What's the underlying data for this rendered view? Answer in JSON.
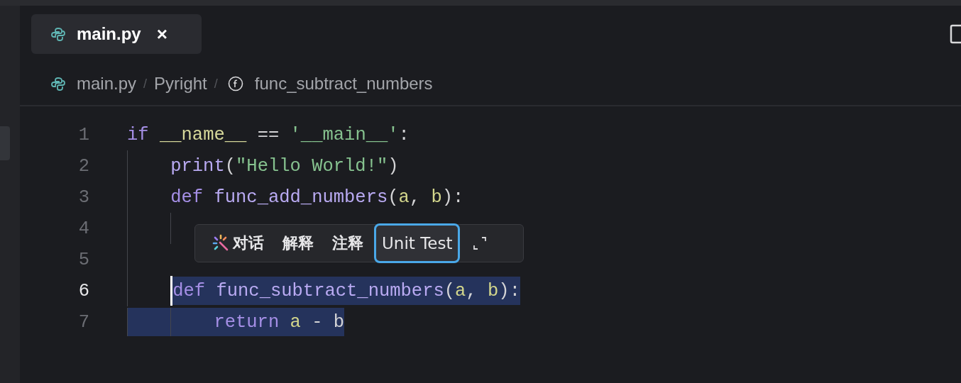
{
  "tabs": [
    {
      "label": "main.py",
      "close": "×",
      "selected": true
    }
  ],
  "breadcrumb": [
    {
      "kind": "file",
      "text": "main.py"
    },
    {
      "kind": "separator",
      "text": "/"
    },
    {
      "kind": "plain",
      "text": "Pyright"
    },
    {
      "kind": "separator",
      "text": "/"
    },
    {
      "kind": "function",
      "text": "func_subtract_numbers"
    }
  ],
  "lines": [
    {
      "number": "1",
      "current": false,
      "cursor": false,
      "tokens": [
        {
          "kind": "keyword",
          "text": "if ",
          "selected": false
        },
        {
          "kind": "dunder",
          "text": "__name__",
          "selected": false
        },
        {
          "kind": "plain",
          "text": " == ",
          "selected": false
        },
        {
          "kind": "string",
          "text": "'__main__'",
          "selected": false
        },
        {
          "kind": "plain",
          "text": ":",
          "selected": false
        }
      ],
      "children": [
        {
          "number": "2",
          "current": false,
          "cursor": false,
          "indent_selected": false,
          "tokens": [
            {
              "kind": "function",
              "text": "print",
              "selected": false
            },
            {
              "kind": "plain",
              "text": "(",
              "selected": false
            },
            {
              "kind": "string",
              "text": "\"Hello World!\"",
              "selected": false
            },
            {
              "kind": "plain",
              "text": ")",
              "selected": false
            }
          ]
        },
        {
          "number": "3",
          "current": false,
          "cursor": false,
          "indent_selected": false,
          "tokens": [
            {
              "kind": "keyword",
              "text": "def ",
              "selected": false
            },
            {
              "kind": "function",
              "text": "func_add_numbers",
              "selected": false
            },
            {
              "kind": "plain",
              "text": "(",
              "selected": false
            },
            {
              "kind": "param",
              "text": "a",
              "selected": false
            },
            {
              "kind": "plain",
              "text": ", ",
              "selected": false
            },
            {
              "kind": "param",
              "text": "b",
              "selected": false
            },
            {
              "kind": "plain",
              "text": "):",
              "selected": false
            }
          ],
          "children": [
            {
              "number": "4",
              "current": false,
              "cursor": false,
              "indent_selected": false
            }
          ]
        },
        {
          "number": "5",
          "current": false,
          "cursor": false,
          "indent_selected": false
        },
        {
          "number": "6",
          "current": true,
          "cursor": true,
          "indent_selected": false,
          "tokens": [
            {
              "kind": "keyword",
              "text": "def ",
              "selected": true
            },
            {
              "kind": "function",
              "text": "func_subtract_numbers",
              "selected": true
            },
            {
              "kind": "plain",
              "text": "(",
              "selected": true
            },
            {
              "kind": "param",
              "text": "a",
              "selected": true
            },
            {
              "kind": "plain",
              "text": ", ",
              "selected": true
            },
            {
              "kind": "param",
              "text": "b",
              "selected": true
            },
            {
              "kind": "plain",
              "text": "):",
              "selected": true
            }
          ],
          "children": [
            {
              "number": "7",
              "current": false,
              "cursor": false,
              "indent_selected": true,
              "tokens": [
                {
                  "kind": "keyword",
                  "text": "return ",
                  "selected": true
                },
                {
                  "kind": "param",
                  "text": "a",
                  "selected": true
                },
                {
                  "kind": "plain",
                  "text": " - ",
                  "selected": true
                },
                {
                  "kind": "plain",
                  "text": "b",
                  "selected": true
                }
              ]
            }
          ]
        }
      ]
    }
  ],
  "popup": {
    "actions": [
      {
        "kind": "chat",
        "label": "对话",
        "selected": false
      },
      {
        "kind": "text",
        "label": "解释",
        "selected": false
      },
      {
        "kind": "text",
        "label": "注释",
        "selected": false
      },
      {
        "kind": "text",
        "label": "Unit Test",
        "selected": true
      },
      {
        "kind": "expand",
        "selected": false
      }
    ]
  }
}
